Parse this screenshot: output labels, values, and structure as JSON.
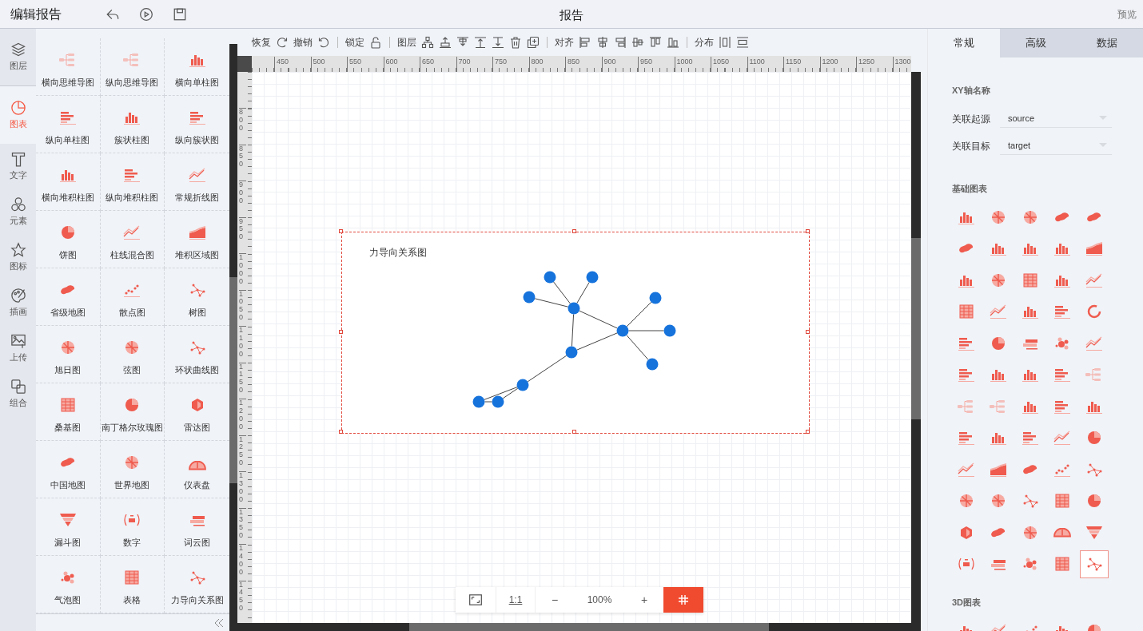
{
  "header": {
    "title": "编辑报告",
    "doc_title": "报告",
    "preview": "预览"
  },
  "rail": [
    {
      "label": "图层",
      "selected": false
    },
    {
      "label": "图表",
      "selected": true
    },
    {
      "label": "文字",
      "selected": false
    },
    {
      "label": "元素",
      "selected": false
    },
    {
      "label": "图标",
      "selected": false
    },
    {
      "label": "插画",
      "selected": false
    },
    {
      "label": "上传",
      "selected": false
    },
    {
      "label": "组合",
      "selected": false
    }
  ],
  "palette": [
    {
      "label": "横向思维导图"
    },
    {
      "label": "纵向思维导图"
    },
    {
      "label": "横向单柱图"
    },
    {
      "label": "纵向单柱图"
    },
    {
      "label": "簇状柱图"
    },
    {
      "label": "纵向簇状图"
    },
    {
      "label": "横向堆积柱图"
    },
    {
      "label": "纵向堆积柱图"
    },
    {
      "label": "常规折线图"
    },
    {
      "label": "饼图"
    },
    {
      "label": "柱线混合图"
    },
    {
      "label": "堆积区域图"
    },
    {
      "label": "省级地图"
    },
    {
      "label": "散点图"
    },
    {
      "label": "树图"
    },
    {
      "label": "旭日图"
    },
    {
      "label": "弦图"
    },
    {
      "label": "环状曲线图"
    },
    {
      "label": "桑基图"
    },
    {
      "label": "南丁格尔玫瑰图"
    },
    {
      "label": "雷达图"
    },
    {
      "label": "中国地图"
    },
    {
      "label": "世界地图"
    },
    {
      "label": "仪表盘"
    },
    {
      "label": "漏斗图"
    },
    {
      "label": "数字"
    },
    {
      "label": "词云图"
    },
    {
      "label": "气泡图"
    },
    {
      "label": "表格"
    },
    {
      "label": "力导向关系图"
    }
  ],
  "toolbar": [
    {
      "label": "恢复"
    },
    {
      "label": "撤销"
    },
    {
      "label": "锁定"
    },
    {
      "label": "图层"
    },
    {
      "label": "对齐"
    },
    {
      "label": "分布"
    }
  ],
  "ruler": {
    "x_labels": [
      "450",
      "500",
      "550",
      "600",
      "650",
      "700",
      "750",
      "800",
      "850",
      "900",
      "950",
      "1000",
      "1050",
      "1100",
      "1150",
      "1200",
      "1250",
      "1300"
    ],
    "y_labels": [
      "800",
      "850",
      "900",
      "950",
      "1000",
      "1050",
      "1100",
      "1150",
      "1200",
      "1250",
      "1300",
      "1350",
      "1400",
      "1450"
    ]
  },
  "canvas": {
    "chart_title": "力导向关系图",
    "selected": true
  },
  "zoom_bar": {
    "one_to_one": "1:1",
    "minus": "−",
    "level_text": "100%",
    "plus": "+",
    "grid_on": true
  },
  "props": {
    "tabs": [
      {
        "label": "常规",
        "selected": true
      },
      {
        "label": "高级",
        "selected": false
      },
      {
        "label": "数据",
        "selected": false
      }
    ],
    "axis_section": "XY轴名称",
    "fields": [
      {
        "label": "关联起源",
        "value": "source"
      },
      {
        "label": "关联目标",
        "value": "target"
      }
    ],
    "basic_title": "基础图表",
    "basic_charts": [
      {
        "selected": false
      },
      {
        "selected": false
      },
      {
        "selected": false
      },
      {
        "selected": false
      },
      {
        "selected": false
      },
      {
        "selected": false
      },
      {
        "selected": false
      },
      {
        "selected": false
      },
      {
        "selected": false
      },
      {
        "selected": false
      },
      {
        "selected": false
      },
      {
        "selected": false
      },
      {
        "selected": false
      },
      {
        "selected": false
      },
      {
        "selected": false
      },
      {
        "selected": false
      },
      {
        "selected": false
      },
      {
        "selected": false
      },
      {
        "selected": false
      },
      {
        "selected": false
      },
      {
        "selected": false
      },
      {
        "selected": false
      },
      {
        "selected": false
      },
      {
        "selected": false
      },
      {
        "selected": false
      },
      {
        "selected": false
      },
      {
        "selected": false
      },
      {
        "selected": false
      },
      {
        "selected": false
      },
      {
        "selected": false
      },
      {
        "selected": false
      },
      {
        "selected": false
      },
      {
        "selected": false
      },
      {
        "selected": false
      },
      {
        "selected": false
      },
      {
        "selected": false
      },
      {
        "selected": false
      },
      {
        "selected": false
      },
      {
        "selected": false
      },
      {
        "selected": false
      },
      {
        "selected": false
      },
      {
        "selected": false
      },
      {
        "selected": false
      },
      {
        "selected": false
      },
      {
        "selected": false
      },
      {
        "selected": false
      },
      {
        "selected": false
      },
      {
        "selected": false
      },
      {
        "selected": false
      },
      {
        "selected": false
      },
      {
        "selected": false
      },
      {
        "selected": false
      },
      {
        "selected": false
      },
      {
        "selected": false
      },
      {
        "selected": false
      },
      {
        "selected": false
      },
      {
        "selected": false
      },
      {
        "selected": false
      },
      {
        "selected": false
      },
      {
        "selected": true
      }
    ],
    "td_title": "3D图表",
    "td_charts": [
      {
        "selected": false
      },
      {
        "selected": false
      },
      {
        "selected": false
      },
      {
        "selected": false
      },
      {
        "selected": false
      }
    ]
  }
}
